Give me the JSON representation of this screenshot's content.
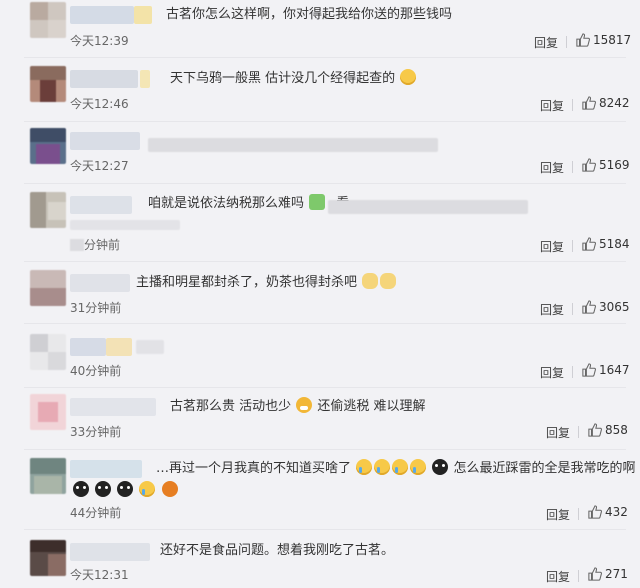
{
  "reply_label": "回复",
  "comments": [
    {
      "text": "古茗你怎么这样啊，你对得起我给你送的那些钱吗",
      "time": "今天12:39",
      "likes": "15817"
    },
    {
      "text": "天下乌鸦一般黑 估计没几个经得起查的",
      "time": "今天12:46",
      "likes": "8242"
    },
    {
      "text": "",
      "time": "今天12:27",
      "likes": "5169"
    },
    {
      "text_a": "咱就是说依法纳税那么难吗",
      "text_b": "看",
      "time": "分钟前",
      "likes": "5184"
    },
    {
      "text": "主播和明星都封杀了，奶茶也得封杀吧",
      "time": "31分钟前",
      "likes": "3065"
    },
    {
      "text": "",
      "time": "40分钟前",
      "likes": "1647"
    },
    {
      "text_a": "古茗那么贵 活动也少",
      "text_b": "还偷逃税 难以理解",
      "time": "33分钟前",
      "likes": "858"
    },
    {
      "text_a": "…再过一个月我真的不知道买啥了",
      "text_b": "怎么最近踩雷的全是我常吃的啊",
      "time": "44分钟前",
      "likes": "432"
    },
    {
      "text": "还好不是食品问题。想着我刚吃了古茗。",
      "time": "今天12:31",
      "likes": "271"
    }
  ],
  "icons": {
    "like": "thumbs-up-icon",
    "emoji": "emoji-icon"
  },
  "colors": {
    "background": "#f2f2f5",
    "text": "#333333",
    "meta": "#666666"
  }
}
